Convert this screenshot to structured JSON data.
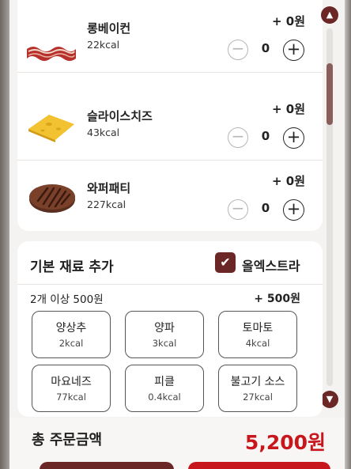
{
  "items": [
    {
      "name": "롱베이컨",
      "kcal": "22kcal",
      "price": "+ 0원",
      "qty": "0",
      "image": "bacon-image"
    },
    {
      "name": "슬라이스치즈",
      "kcal": "43kcal",
      "price": "+ 0원",
      "qty": "0",
      "image": "cheese-image"
    },
    {
      "name": "와퍼패티",
      "kcal": "227kcal",
      "price": "+ 0원",
      "qty": "0",
      "image": "patty-image"
    }
  ],
  "stepper": {
    "minus": "−",
    "plus": "+"
  },
  "basic": {
    "title": "기본 재료 추가",
    "extra_label": "올엑스트라",
    "extra_checked": true,
    "rule_text": "2개 이상 500원",
    "rule_price": "+ 500원",
    "options": [
      {
        "name": "양상추",
        "kcal": "2kcal"
      },
      {
        "name": "양파",
        "kcal": "3kcal"
      },
      {
        "name": "토마토",
        "kcal": "4kcal"
      },
      {
        "name": "마요네즈",
        "kcal": "77kcal"
      },
      {
        "name": "피클",
        "kcal": "0.4kcal"
      },
      {
        "name": "불고기 소스",
        "kcal": "27kcal"
      }
    ]
  },
  "total": {
    "label": "총 주문금액",
    "price": "5,200원"
  },
  "colors": {
    "accent": "#6b2626",
    "price_red": "#c8161d"
  }
}
